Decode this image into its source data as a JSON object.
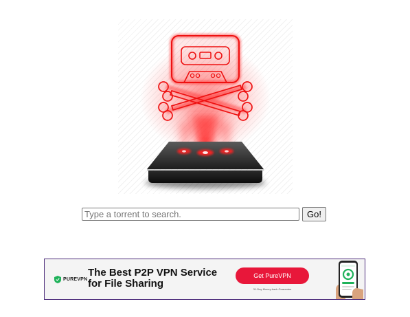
{
  "search": {
    "placeholder": "Type a torrent to search.",
    "value": "",
    "submit_label": "Go!"
  },
  "ad": {
    "brand": "PUREVPN",
    "headline_line1": "The Best P2P VPN Service",
    "headline_line2": "for File Sharing",
    "cta_label": "Get PureVPN",
    "guarantee": "31-Day Money-back Guarantee"
  },
  "colors": {
    "logo_glow": "#ff1a1a",
    "ad_cta": "#e8173a",
    "ad_border": "#4b2a7a",
    "brand_green": "#1fb25a"
  },
  "icons": {
    "logo": "hologram-cassette-skull-logo-icon",
    "brand": "purevpn-shield-icon",
    "phone": "phone-app-icon"
  }
}
